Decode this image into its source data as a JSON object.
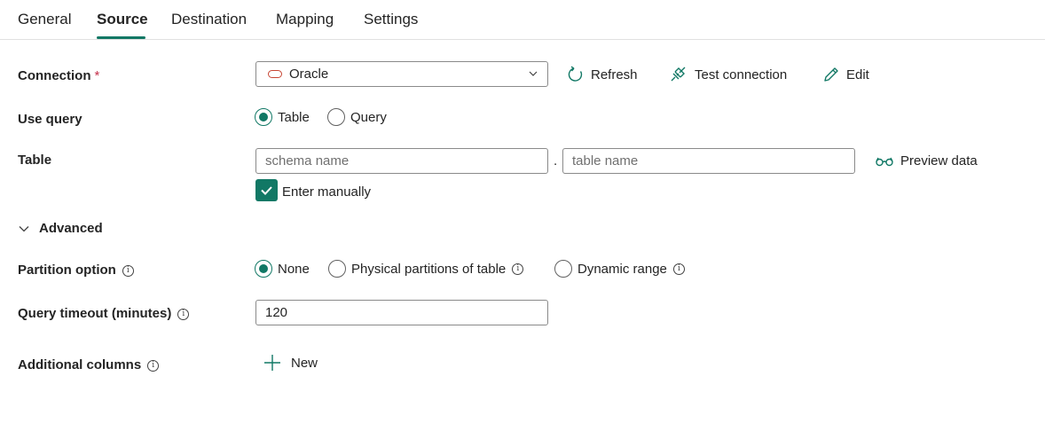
{
  "tabs": [
    {
      "label": "General"
    },
    {
      "label": "Source",
      "active": true
    },
    {
      "label": "Destination"
    },
    {
      "label": "Mapping"
    },
    {
      "label": "Settings"
    }
  ],
  "connection": {
    "label": "Connection",
    "required_marker": "*",
    "selected": "Oracle",
    "icon": "oracle-icon",
    "actions": {
      "refresh": "Refresh",
      "test": "Test connection",
      "edit": "Edit"
    }
  },
  "use_query": {
    "label": "Use query",
    "options": [
      "Table",
      "Query"
    ],
    "selected": "Table"
  },
  "table": {
    "label": "Table",
    "schema_placeholder": "schema name",
    "separator": ".",
    "table_placeholder": "table name",
    "preview_label": "Preview data",
    "enter_manually_label": "Enter manually",
    "enter_manually_checked": true
  },
  "advanced": {
    "label": "Advanced",
    "expanded": true
  },
  "partition": {
    "label": "Partition option",
    "options": [
      "None",
      "Physical partitions of table",
      "Dynamic range"
    ],
    "selected": "None"
  },
  "query_timeout": {
    "label": "Query timeout (minutes)",
    "value": "120"
  },
  "additional_columns": {
    "label": "Additional columns",
    "new_label": "New"
  },
  "colors": {
    "accent": "#117865",
    "required": "#c4314b",
    "oracle": "#c74634",
    "border": "#8a8a8a"
  }
}
